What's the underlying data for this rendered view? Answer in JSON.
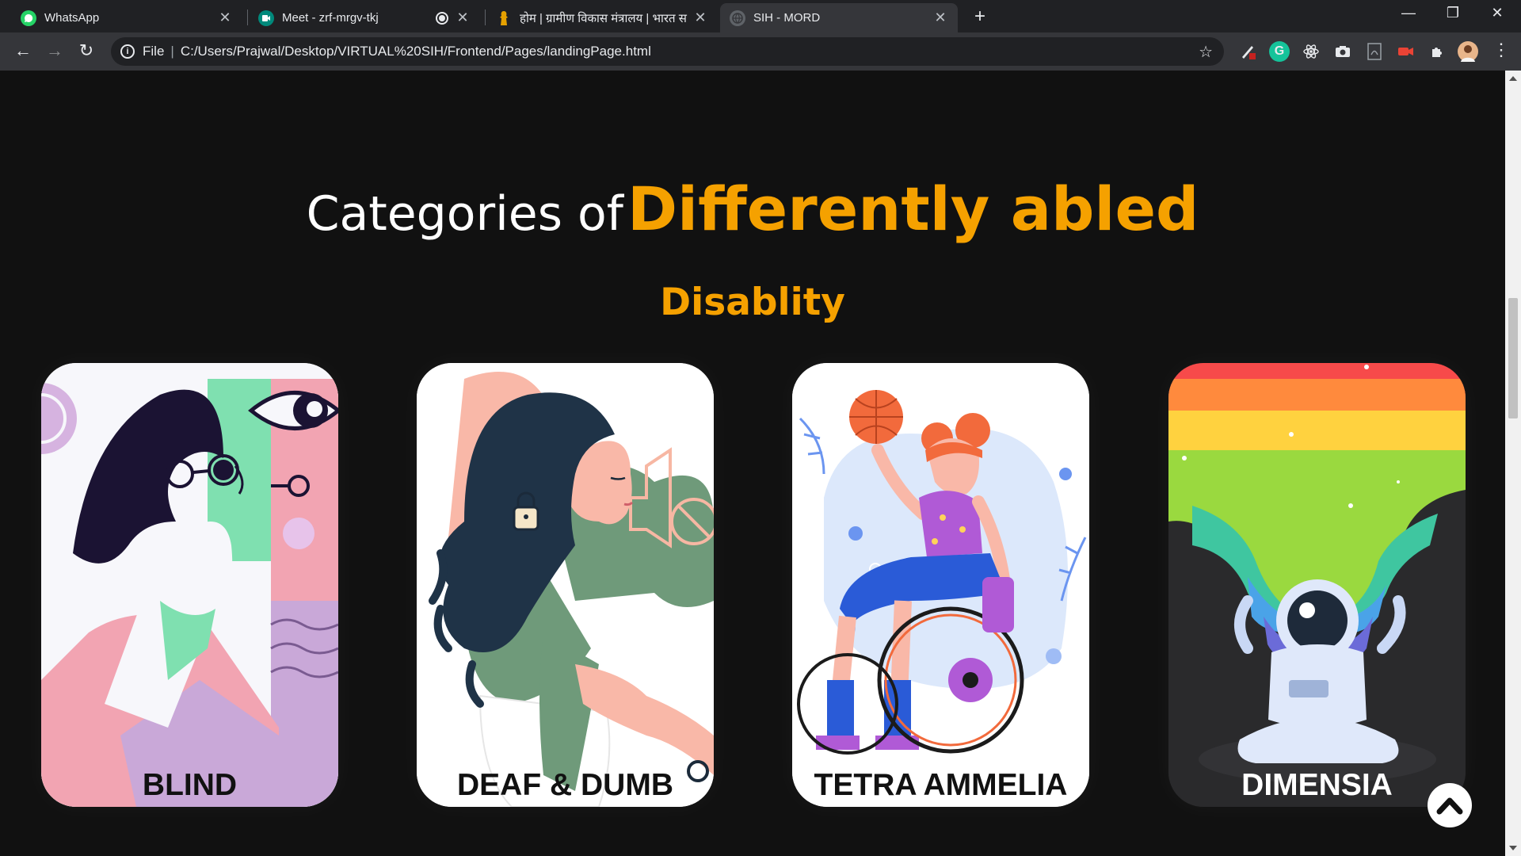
{
  "browser": {
    "tabs": [
      {
        "title": "WhatsApp",
        "icon": "whatsapp-icon",
        "color": "#25d366"
      },
      {
        "title": "Meet - zrf-mrgv-tkj",
        "icon": "google-meet-icon",
        "color": "#00897b",
        "recording": true
      },
      {
        "title": "होम | ग्रामीण विकास मंत्रालय | भारत स",
        "icon": "emblem-icon",
        "color": "#e6a100"
      },
      {
        "title": "SIH - MORD",
        "icon": "globe-icon",
        "color": "#9aa0a6",
        "active": true
      }
    ],
    "address": {
      "scheme_label": "File",
      "url": "C:/Users/Prajwal/Desktop/VIRTUAL%20SIH/Frontend/Pages/landingPage.html"
    }
  },
  "page": {
    "heading_prefix": "Categories of",
    "heading_highlight": "Differently abled",
    "subheading": "Disablity",
    "cards": [
      {
        "label": "BLIND"
      },
      {
        "label": "DEAF & DUMB"
      },
      {
        "label": "TETRA AMMELIA"
      },
      {
        "label": "DIMENSIA"
      }
    ]
  },
  "colors": {
    "accent": "#f5a100",
    "background": "#111111",
    "chrome_dark": "#202124",
    "chrome_toolbar": "#35363a"
  }
}
